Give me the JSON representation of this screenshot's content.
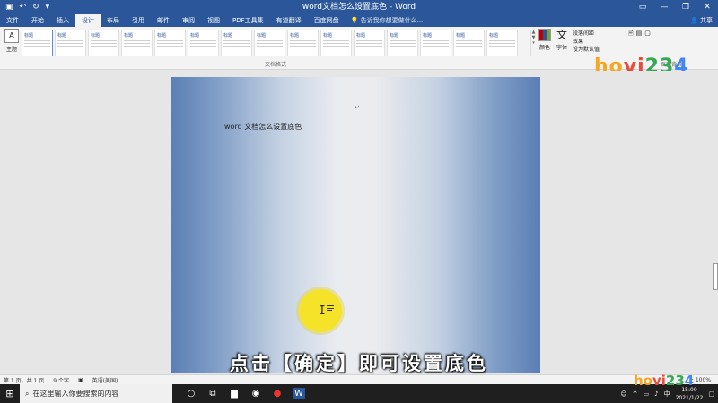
{
  "window": {
    "title": "word文档怎么设置底色 - Word",
    "qat_icons": [
      "save-icon",
      "undo-icon",
      "redo-icon",
      "customize-icon"
    ],
    "controls": [
      "ribbon-display-icon",
      "minimize-icon",
      "maximize-icon",
      "close-icon"
    ]
  },
  "tabs": [
    "文件",
    "开始",
    "插入",
    "设计",
    "布局",
    "引用",
    "邮件",
    "审阅",
    "视图",
    "PDF工具集",
    "有道翻译",
    "百度网盘"
  ],
  "active_tab": "设计",
  "tell_me": "告诉我你想要做什么...",
  "share": "共享",
  "ribbon": {
    "theme_label": "主题",
    "style_titles": [
      "标题",
      "标题",
      "标题",
      "标题",
      "标题",
      "标题",
      "标题",
      "标题",
      "标题",
      "标题",
      "标题",
      "标题",
      "标题",
      "标题",
      "标题"
    ],
    "group_label": "文档格式",
    "colors_label": "颜色",
    "fonts_label": "字体",
    "para_items": [
      "段落间距",
      "效果",
      "设为默认值"
    ],
    "bg_label": "页面背景"
  },
  "document": {
    "text": "word 文档怎么设置底色",
    "paragraph_mark": "↵"
  },
  "subtitle": "点击【确定】即可设置底色",
  "status": {
    "page": "第 1 页，共 1 页",
    "words": "9 个字",
    "language": "英语(美国)",
    "zoom": "+ 100%"
  },
  "taskbar": {
    "search_placeholder": "在这里输入你要搜索的内容",
    "time": "15:00",
    "date": "2021/1/22",
    "ime": "中"
  },
  "watermark": {
    "parts": [
      "ho",
      "vi",
      "23",
      "4"
    ]
  }
}
